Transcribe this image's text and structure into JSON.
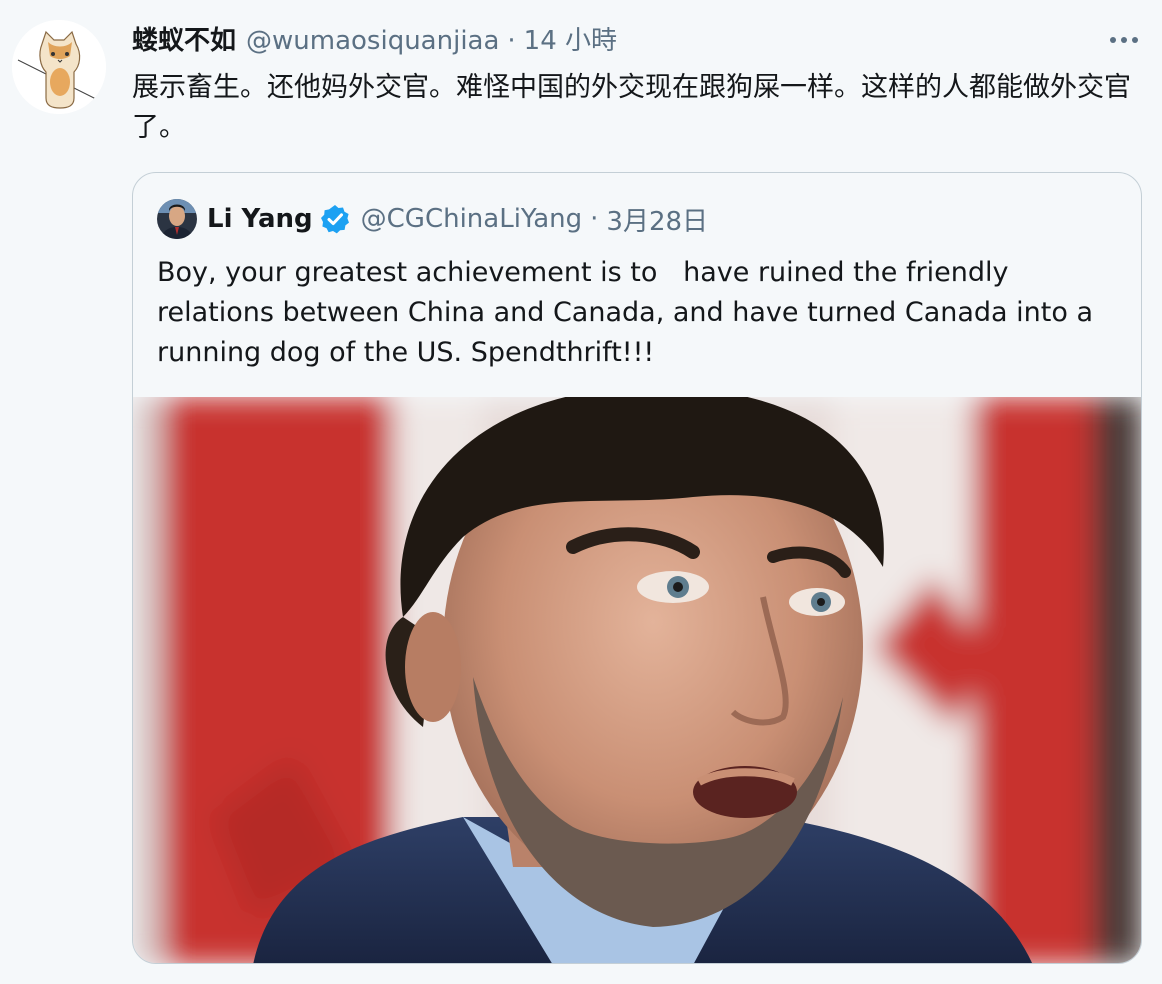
{
  "tweet": {
    "author": {
      "display_name": "蝼蚁不如",
      "handle": "@wumaosiquanjiaa",
      "separator": "·",
      "timestamp": "14 小時",
      "avatar_icon": "cat-avatar-icon"
    },
    "more_icon": "more-dots-icon",
    "text": "展示畜生。还他妈外交官。难怪中国的外交现在跟狗屎一样。这样的人都能做外交官了。",
    "quoted": {
      "display_name": "Li Yang",
      "verified_icon": "verified-badge-icon",
      "handle": "@CGChinaLiYang",
      "separator": "·",
      "timestamp": "3月28日",
      "text": "Boy, your greatest achievement is to   have ruined the friendly relations between China and Canada, and have turned Canada into a running dog of the US. Spendthrift!!!",
      "media": {
        "type": "photo",
        "icon": "portrait-photo"
      }
    }
  },
  "colors": {
    "background": "#f5f8fa",
    "text_primary": "#14171a",
    "text_secondary": "#5b7083",
    "border": "#c4cfd6",
    "verified_blue": "#1da1f2",
    "flag_red": "#c8332e"
  }
}
